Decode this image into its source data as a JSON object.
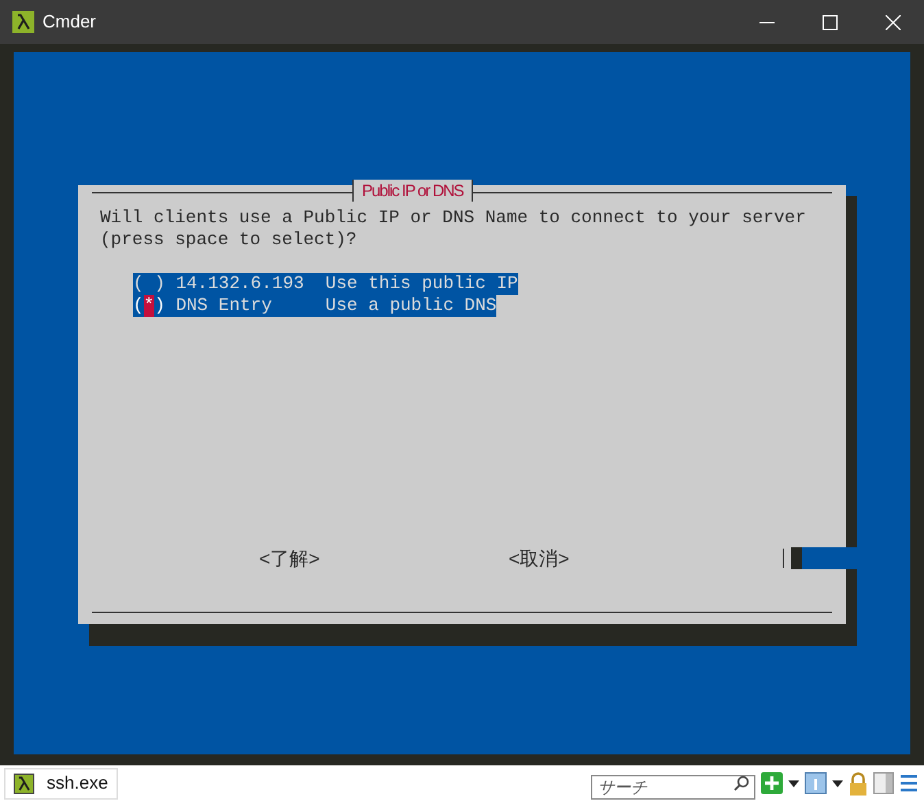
{
  "window": {
    "title": "Cmder"
  },
  "dialog": {
    "title": "Public IP or DNS",
    "prompt_lines": [
      "Will clients use a Public IP or DNS Name to connect to your server",
      "(press space to select)?"
    ],
    "options": [
      {
        "mark": "( )",
        "value": "14.132.6.193",
        "description": "Use this public IP",
        "checked": false
      },
      {
        "mark": "(*)",
        "value": "DNS Entry",
        "description": "Use a public DNS",
        "checked": true
      }
    ],
    "buttons": [
      "<了解>",
      "<取消>"
    ]
  },
  "status_bar": {
    "tab": "ssh.exe",
    "search": {
      "placeholder": "サーチ"
    }
  }
}
